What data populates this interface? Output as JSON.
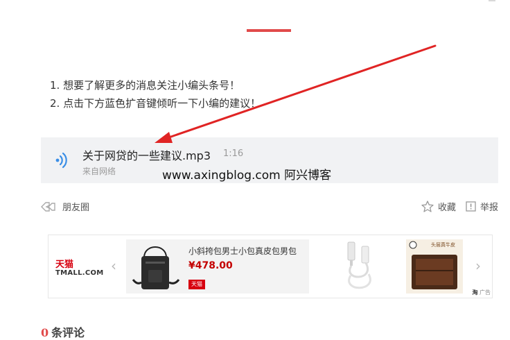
{
  "tips": [
    "1. 想要了解更多的消息关注小编头条号！",
    "2. 点击下方蓝色扩音键倾听一下小编的建议！"
  ],
  "audio": {
    "title": "关于网贷的一些建议.mp3",
    "duration": "1:16",
    "source": "来自网络",
    "icon": "sound-wave-icon"
  },
  "watermark": "www.axingblog.com 阿兴博客",
  "actions": {
    "moments_label": "朋友圈",
    "favorite_label": "收藏",
    "report_label": "举报"
  },
  "ad": {
    "brand_cn": "天猫",
    "brand_en": "TMALL.COM",
    "product_name": "小斜挎包男士小包真皮包男包",
    "product_price": "¥478.00",
    "tag": "天猫",
    "wallet_caption": "头层真牛皮",
    "ad_mark_brand": "淘",
    "ad_mark_label": "广告"
  },
  "comments": {
    "count": "0",
    "label": "条评论"
  },
  "colors": {
    "accent": "#e14b4b",
    "audio_bg": "#f1f2f4",
    "wave_blue": "#3a8ee6",
    "price_red": "#c40000"
  }
}
